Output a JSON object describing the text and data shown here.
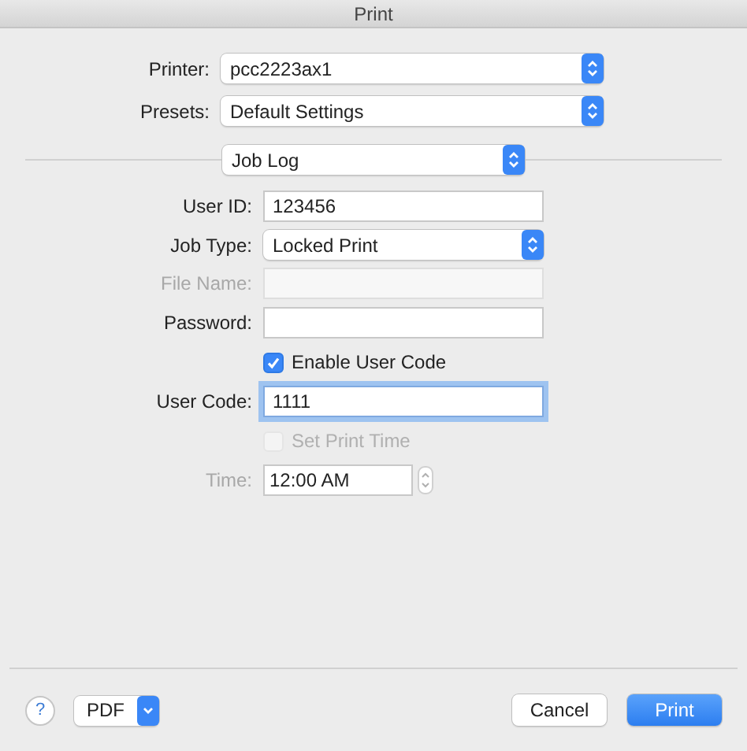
{
  "window": {
    "title": "Print"
  },
  "printer": {
    "label": "Printer:",
    "value": "pcc2223ax1"
  },
  "presets": {
    "label": "Presets:",
    "value": "Default Settings"
  },
  "section_menu": {
    "value": "Job Log"
  },
  "fields": [
    {
      "kind": "text",
      "label": "User ID:",
      "value": "123456",
      "disabled": false,
      "focused": false
    },
    {
      "kind": "popup",
      "label": "Job Type:",
      "value": "Locked Print",
      "disabled": false
    },
    {
      "kind": "text",
      "label": "File Name:",
      "disabled": true,
      "focused": false
    },
    {
      "kind": "text",
      "label": "Password:",
      "disabled": false,
      "focused": false
    },
    {
      "kind": "checkbox",
      "label": "Enable User Code",
      "checked": true,
      "disabled": false
    },
    {
      "kind": "text",
      "label": "User Code:",
      "value": "1111",
      "disabled": false,
      "focused": true
    },
    {
      "kind": "checkbox",
      "label": "Set Print Time",
      "checked": false,
      "disabled": true
    },
    {
      "kind": "time",
      "label": "Time:",
      "value": "12:00 AM",
      "disabled": true
    }
  ],
  "footer": {
    "help": "?",
    "pdf": "PDF",
    "buttons": [
      {
        "label": "Cancel",
        "default": false
      },
      {
        "label": "Print",
        "default": true
      }
    ]
  }
}
